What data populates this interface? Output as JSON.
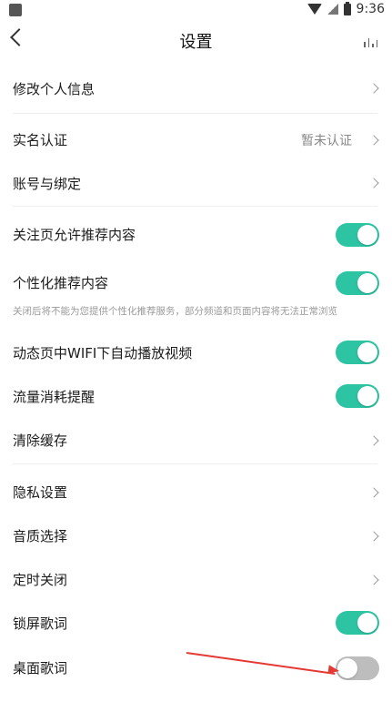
{
  "status_bar": {
    "time": "9:36"
  },
  "header": {
    "title": "设置"
  },
  "settings": [
    {
      "label": "修改个人信息",
      "type": "link"
    },
    {
      "label": "实名认证",
      "type": "link",
      "value": "暂未认证"
    },
    {
      "label": "账号与绑定",
      "type": "link"
    },
    {
      "label": "关注页允许推荐内容",
      "type": "toggle",
      "on": true
    },
    {
      "label": "个性化推荐内容",
      "type": "toggle",
      "on": true,
      "description": "关闭后将不能为您提供个性化推荐服务，部分频道和页面内容将无法正常浏览"
    },
    {
      "label": "动态页中WIFI下自动播放视频",
      "type": "toggle",
      "on": true
    },
    {
      "label": "流量消耗提醒",
      "type": "toggle",
      "on": true
    },
    {
      "label": "清除缓存",
      "type": "link"
    },
    {
      "label": "隐私设置",
      "type": "link"
    },
    {
      "label": "音质选择",
      "type": "link"
    },
    {
      "label": "定时关闭",
      "type": "link"
    },
    {
      "label": "锁屏歌词",
      "type": "toggle",
      "on": true
    },
    {
      "label": "桌面歌词",
      "type": "toggle",
      "on": false
    }
  ],
  "colors": {
    "toggle_on": "#2cc4a3",
    "toggle_off": "#bdbdbd",
    "annotation_arrow": "#e53935"
  }
}
